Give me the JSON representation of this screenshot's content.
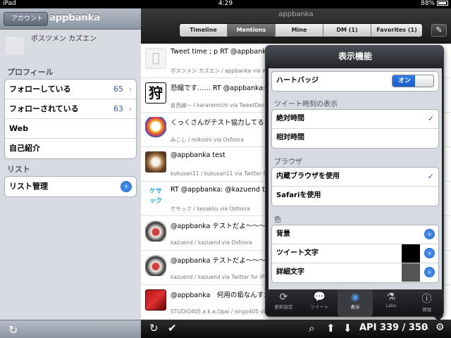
{
  "status": {
    "carrier": "iPad",
    "time": "4:29",
    "battery": "88%"
  },
  "left": {
    "back_label": "アカウント",
    "title": "appbanka",
    "profile_name": "ボスツメン カズエン",
    "sections": [
      {
        "label": "プロフィール",
        "items": [
          {
            "label": "フォローしている",
            "count": "65"
          },
          {
            "label": "フォローされている",
            "count": "63"
          },
          {
            "label": "Web",
            "count": ""
          },
          {
            "label": "自己紹介",
            "count": ""
          }
        ]
      },
      {
        "label": "リスト",
        "items": [
          {
            "label": "リスト管理",
            "count": ""
          }
        ]
      }
    ]
  },
  "right": {
    "title": "appbanka",
    "tabs": [
      "Timeline",
      "Mentions",
      "Mine",
      "DM (1)",
      "Favorites (1)"
    ],
    "active_tab": "Mentions",
    "tweets": [
      {
        "text": "Tweet time ; p RT @appbanka twe",
        "meta": "ボスツメン カズエン / appbanka via web",
        "avatar": "apple-icon"
      },
      {
        "text": "恐縮です…… RT @appbanka: te",
        "meta": "倉西誠一 / kararemichi via TweetDeck",
        "avatar": "kanji-icon"
      },
      {
        "text": "くっくさんがテスト協力してる www",
        "meta": "みこし / mikoshi via Osfoora",
        "avatar": "character-icon"
      },
      {
        "text": "@appbanka test",
        "meta": "kukusan11 / kukusan11 via Twitter for iP",
        "avatar": "dog-icon"
      },
      {
        "text": "RT @appbanka: @kazuend test",
        "meta": "ケサック / kesakku via Osfoora",
        "avatar": "text-logo-icon"
      },
      {
        "text": "@appbanka テストだよ～～～～ん",
        "meta": "kazuend / kazuend via Osfoora",
        "avatar": "dog-small-icon"
      },
      {
        "text": "@appbanka テストだよ～～～～ん",
        "meta": "kazuend / kazuend via Twitter for iPhone",
        "avatar": "dog-small-icon"
      },
      {
        "text": "@appbanka　何用の垢なんすか？",
        "meta": "STUDIO405.a.k.a.Opai / singo405 via w",
        "avatar": "guitar-icon"
      }
    ],
    "api_text": "API 339 / 350"
  },
  "popover": {
    "title": "表示機能",
    "heart_badge_label": "ハートバッジ",
    "toggle_label": "オン",
    "sec_time": "ツイート時刻の表示",
    "time_absolute": "絶対時間",
    "time_relative": "相対時間",
    "sec_browser": "ブラウザ",
    "browser_internal": "内蔵ブラウザを使用",
    "browser_safari": "Safariを使用",
    "sec_color": "色",
    "color_bg": "背景",
    "color_tweet": "ツイート文字",
    "color_detail": "詳細文字",
    "colors": {
      "bg": "#ffffff",
      "tweet": "#000000",
      "detail": "#555555"
    },
    "tabs": [
      "更新設定",
      "ツイート",
      "表示",
      "Labs",
      "情報"
    ],
    "active_tab": "表示"
  }
}
